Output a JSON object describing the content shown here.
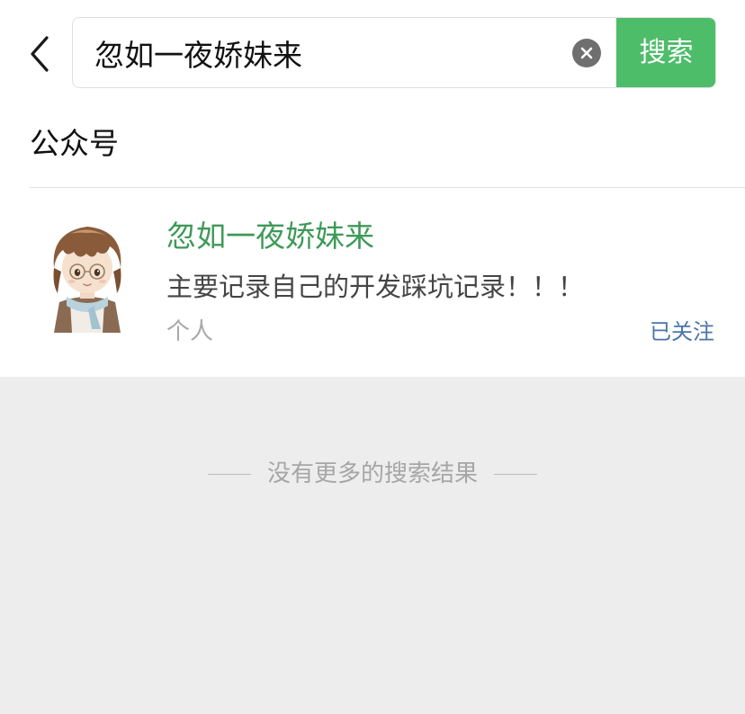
{
  "header": {
    "search": {
      "value": "忽如一夜娇妹来",
      "placeholder": ""
    },
    "search_button_label": "搜索"
  },
  "section": {
    "title": "公众号"
  },
  "results": [
    {
      "name": "忽如一夜娇妹来",
      "description": "主要记录自己的开发踩坑记录！！！",
      "type": "个人",
      "follow_status": "已关注"
    }
  ],
  "footer": {
    "no_more_text": "没有更多的搜索结果"
  },
  "colors": {
    "accent_green": "#4dbd69",
    "name_green": "#3d9a57",
    "link_blue": "#4a74a9",
    "background_gray": "#ededed"
  },
  "icons": [
    "back-arrow-icon",
    "clear-icon"
  ]
}
